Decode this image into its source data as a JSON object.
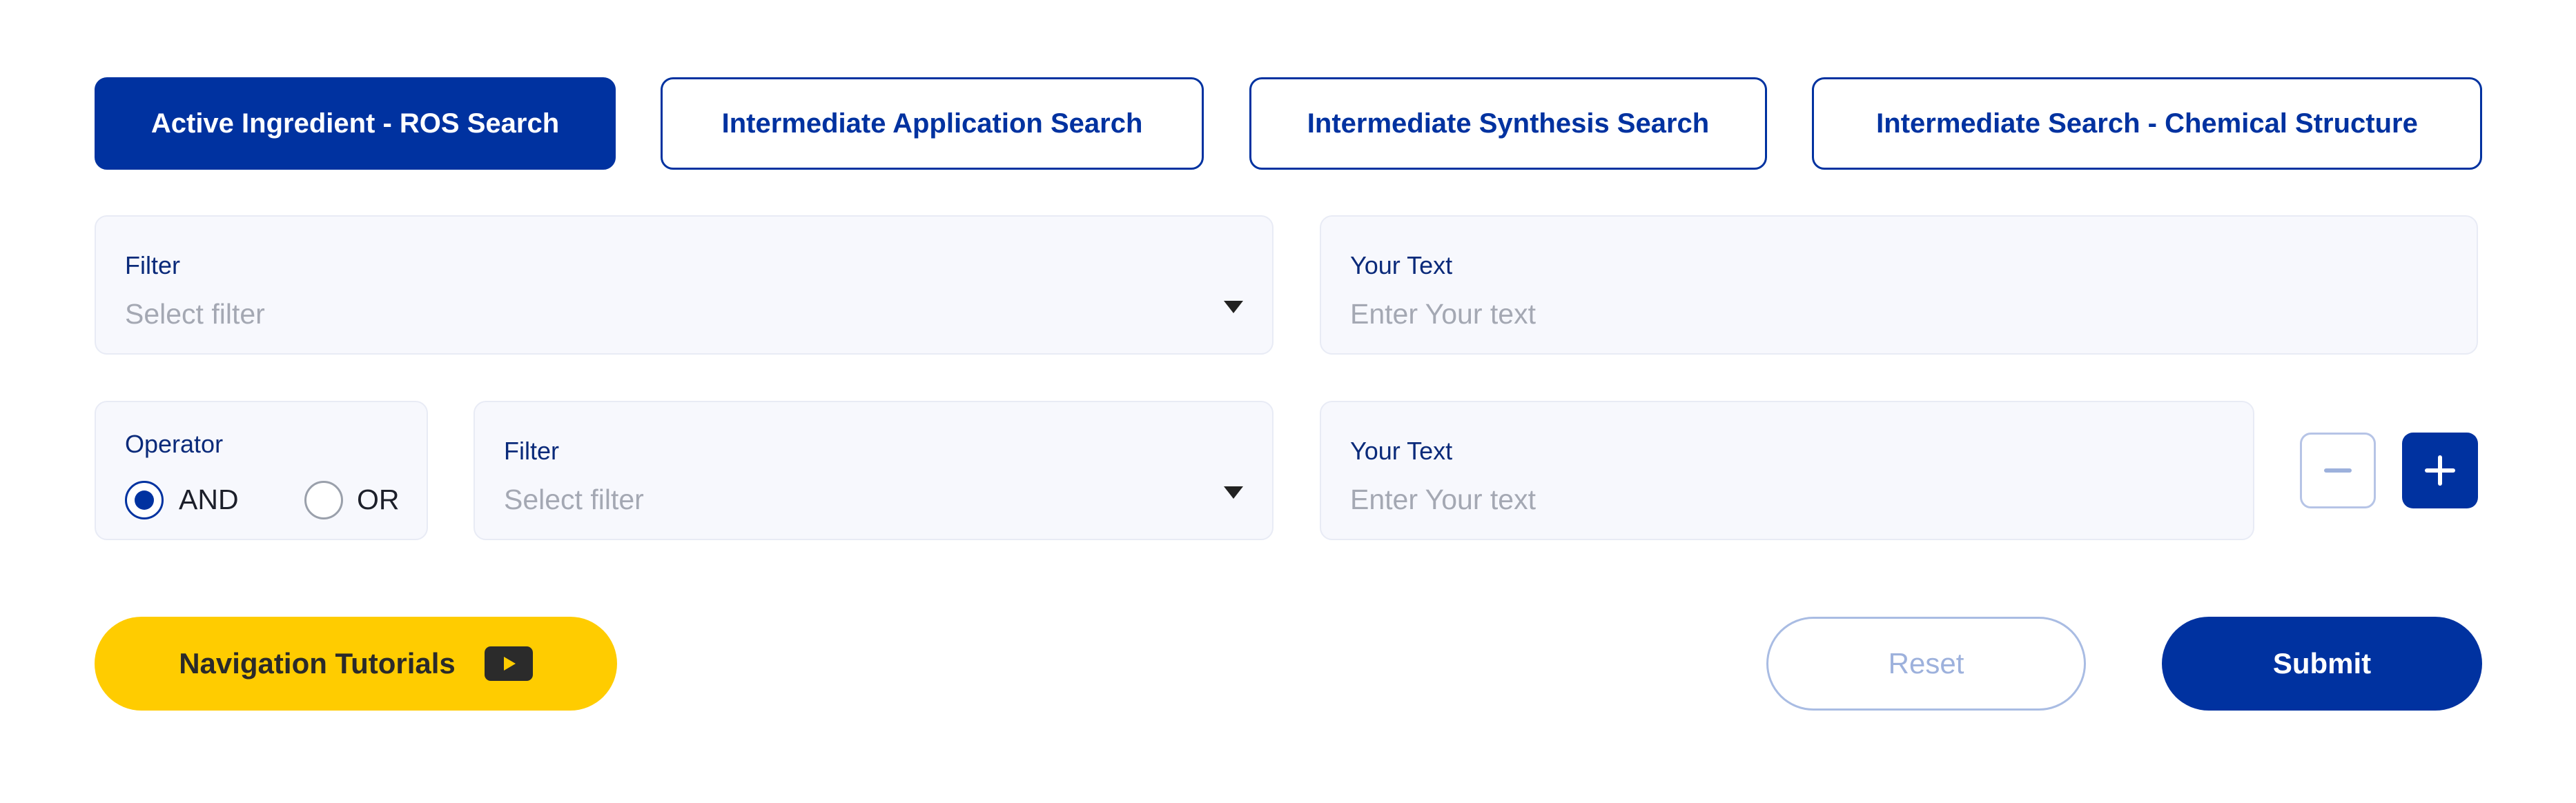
{
  "tabs": [
    {
      "label": "Active Ingredient - ROS Search",
      "active": true
    },
    {
      "label": "Intermediate Application Search",
      "active": false
    },
    {
      "label": "Intermediate Synthesis Search",
      "active": false
    },
    {
      "label": "Intermediate Search - Chemical Structure",
      "active": false
    }
  ],
  "row1": {
    "filter": {
      "label": "Filter",
      "placeholder": "Select filter"
    },
    "text": {
      "label": "Your Text",
      "placeholder": "Enter Your text"
    }
  },
  "row2": {
    "operator": {
      "label": "Operator",
      "options": [
        "AND",
        "OR"
      ],
      "selected": "AND"
    },
    "filter": {
      "label": "Filter",
      "placeholder": "Select filter"
    },
    "text": {
      "label": "Your Text",
      "placeholder": "Enter Your text"
    }
  },
  "actions": {
    "tutorials_label": "Navigation Tutorials",
    "reset_label": "Reset",
    "submit_label": "Submit"
  },
  "icons": {
    "dropdown": "caret-down-icon",
    "remove": "minus-icon",
    "add": "plus-icon",
    "tutorial": "play-icon"
  },
  "colors": {
    "primary": "#0032a0",
    "accent_yellow": "#ffcc00",
    "field_bg": "#f7f8fd",
    "muted_blue": "#9db1dc"
  }
}
